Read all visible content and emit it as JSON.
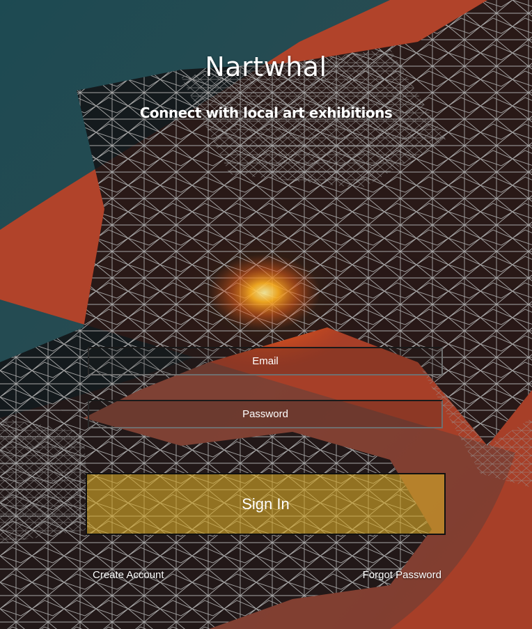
{
  "app": {
    "title": "Nartwhal",
    "subtitle": "Connect with local art exhibitions"
  },
  "login": {
    "email_placeholder": "Email",
    "password_placeholder": "Password",
    "signin_label": "Sign In"
  },
  "links": {
    "create_account": "Create Account",
    "forgot_password": "Forgot Password"
  },
  "colors": {
    "sky": "#1f4d55",
    "lava": "#b5452a",
    "wireframe": "#b7b7b7",
    "signin_fill": "#d6aa28"
  }
}
